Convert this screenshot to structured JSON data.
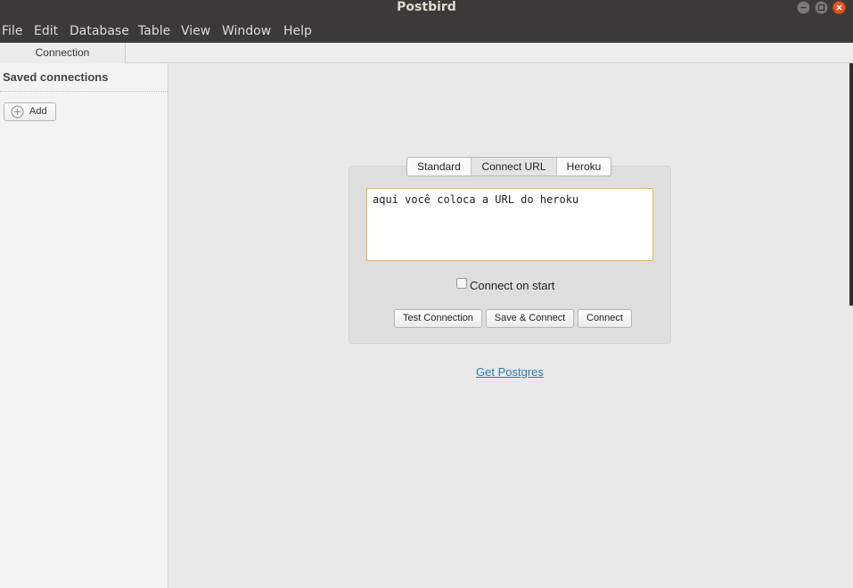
{
  "window": {
    "title": "Postbird"
  },
  "menu": [
    "File",
    "Edit",
    "Database",
    "Table",
    "View",
    "Window",
    "Help"
  ],
  "tabs": {
    "connection": "Connection"
  },
  "sidebar": {
    "title": "Saved connections",
    "add_label": "Add"
  },
  "connect_panel": {
    "modes": [
      "Standard",
      "Connect URL",
      "Heroku"
    ],
    "active_mode": "Connect URL",
    "url_value": "aqui você coloca a URL do heroku",
    "connect_on_start_label": "Connect on start",
    "connect_on_start_checked": false,
    "buttons": {
      "test": "Test Connection",
      "save_connect": "Save & Connect",
      "connect": "Connect"
    }
  },
  "link": {
    "get_postgres": "Get Postgres"
  },
  "colors": {
    "accent_orange": "#e95420",
    "link_blue": "#2f7bb6",
    "focus_border": "#e0b36b"
  }
}
